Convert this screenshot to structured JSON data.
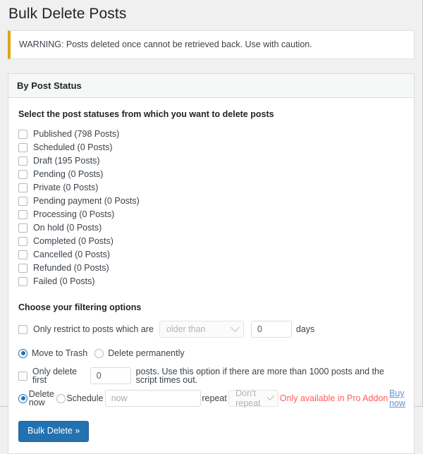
{
  "page": {
    "title": "Bulk Delete Posts"
  },
  "notice": {
    "text": "WARNING: Posts deleted once cannot be retrieved back. Use with caution."
  },
  "panel": {
    "header": "By Post Status",
    "instruction": "Select the post statuses from which you want to delete posts",
    "statuses": [
      {
        "label": "Published (798 Posts)",
        "checked": false
      },
      {
        "label": "Scheduled (0 Posts)",
        "checked": false
      },
      {
        "label": "Draft (195 Posts)",
        "checked": false
      },
      {
        "label": "Pending (0 Posts)",
        "checked": false
      },
      {
        "label": "Private (0 Posts)",
        "checked": false
      },
      {
        "label": "Pending payment (0 Posts)",
        "checked": false
      },
      {
        "label": "Processing (0 Posts)",
        "checked": false
      },
      {
        "label": "On hold (0 Posts)",
        "checked": false
      },
      {
        "label": "Completed (0 Posts)",
        "checked": false
      },
      {
        "label": "Cancelled (0 Posts)",
        "checked": false
      },
      {
        "label": "Refunded (0 Posts)",
        "checked": false
      },
      {
        "label": "Failed (0 Posts)",
        "checked": false
      }
    ]
  },
  "filters": {
    "heading": "Choose your filtering options",
    "restrict": {
      "label": "Only restrict to posts which are",
      "checked": false,
      "comparator_value": "older than",
      "days_value": "0",
      "days_suffix": "days"
    },
    "delete_mode": {
      "trash_label": "Move to Trash",
      "trash_selected": true,
      "permanent_label": "Delete permanently",
      "permanent_selected": false
    },
    "limit": {
      "checked": false,
      "label_before": "Only delete first",
      "count_value": "0",
      "label_after": "posts. Use this option if there are more than 1000 posts and the script times out."
    },
    "schedule": {
      "now_label": "Delete now",
      "now_selected": true,
      "schedule_label": "Schedule",
      "schedule_selected": false,
      "schedule_placeholder": "now",
      "repeat_label": "repeat",
      "repeat_value": "Don't repeat",
      "pro_note": "Only available in Pro Addon",
      "pro_link": "Buy now"
    }
  },
  "submit": {
    "label": "Bulk Delete »"
  },
  "colors": {
    "accent": "#2271b1",
    "warning_bar": "#dba617",
    "pro_red": "#ff5c5c",
    "page_bg": "#f0f0f1"
  }
}
